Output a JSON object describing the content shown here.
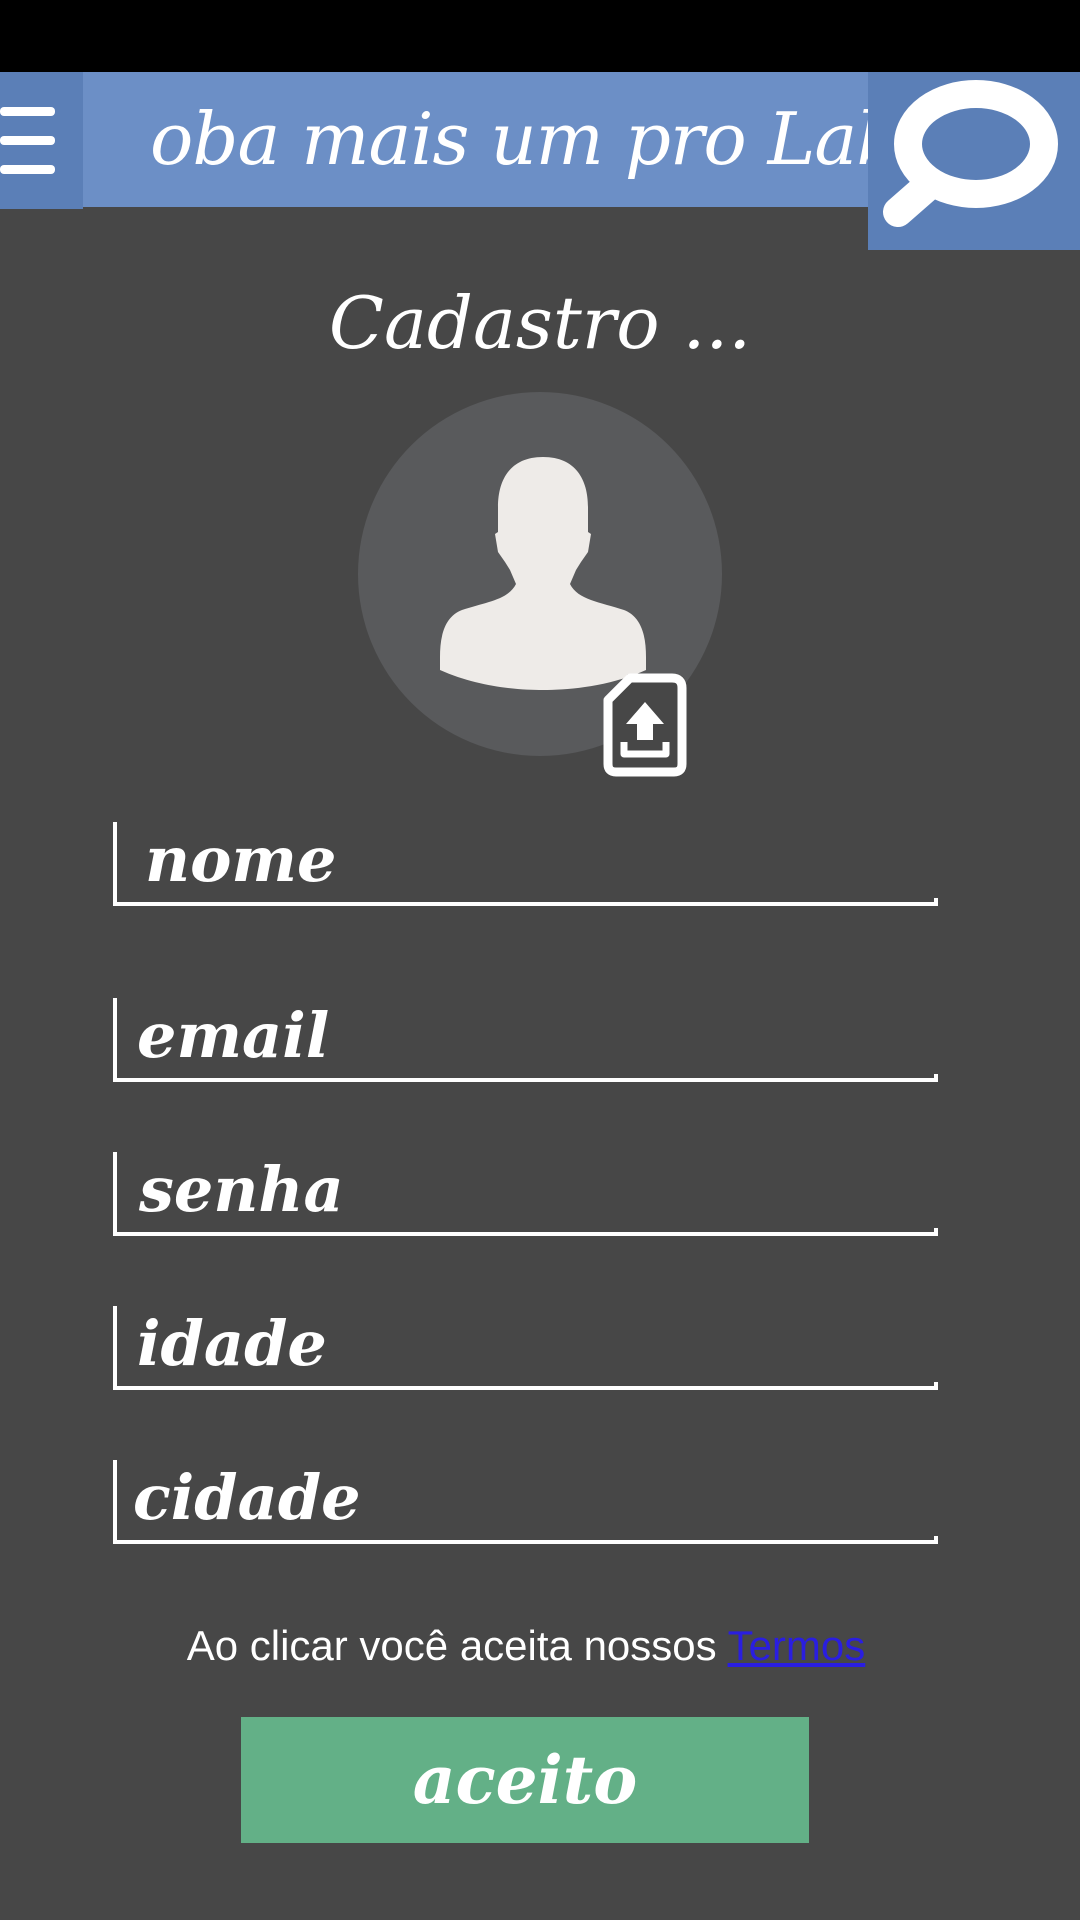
{
  "header": {
    "app_title": "oba mais um pro Lab",
    "menu_icon": "hamburger-menu-icon",
    "search_icon": "magnifier-icon"
  },
  "page": {
    "title": "Cadastro ..."
  },
  "avatar": {
    "icon": "user-silhouette-icon",
    "upload_icon": "file-upload-icon"
  },
  "form": {
    "fields": [
      {
        "placeholder": "nome"
      },
      {
        "placeholder": "email"
      },
      {
        "placeholder": "senha"
      },
      {
        "placeholder": "idade"
      },
      {
        "placeholder": "cidade"
      }
    ],
    "terms_text": "Ao clicar você aceita nossos ",
    "terms_link": "Termos",
    "submit_label": "aceito"
  },
  "colors": {
    "background": "#474747",
    "header": "#6c8fc6",
    "header_dark": "#5b7fb7",
    "avatar_circle": "#595a5c",
    "avatar_figure": "#eeebe8",
    "button": "#63b087",
    "link": "#2a1ee0"
  }
}
